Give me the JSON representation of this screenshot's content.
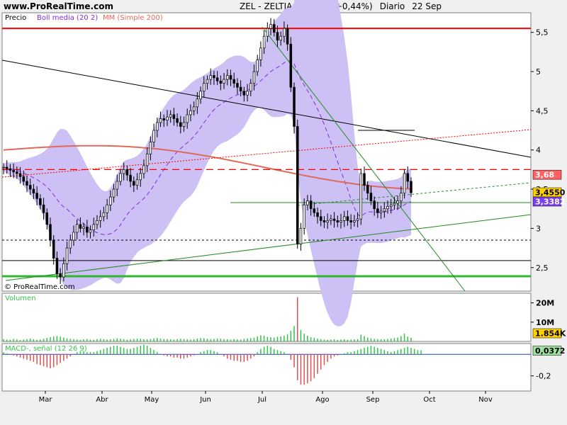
{
  "header": {
    "site": "www.ProRealTime.com",
    "symbol": "ZEL - ZELTIA",
    "price": "3,4550 (+0,44%)",
    "period": "Diario",
    "date": "22 Sep"
  },
  "watermark": "© ProRealTime.com",
  "colors": {
    "candle_up": "#ffffff",
    "candle_down": "#000000",
    "boll_band": "#ccc0f4",
    "boll_mid": "#8a2be2",
    "mm200": "#e06a5a",
    "support_red": "#ff0000",
    "trend_green": "#228b22",
    "volume": "#34c34a",
    "macd_pos": "#34c34a",
    "macd_neg": "#e05050"
  },
  "chart_data": [
    {
      "type": "candlestick",
      "legend": [
        "Precio",
        "Boll media (20 2)",
        "MM (Simple 200)"
      ],
      "x_ticks": [
        "Mar",
        "Abr",
        "May",
        "Jun",
        "Jul",
        "Ago",
        "Sep",
        "Oct",
        "Nov"
      ],
      "y_ticks": [
        "2,5",
        "3",
        "3,5",
        "4",
        "4,5",
        "5",
        "5,5"
      ],
      "ylim": [
        2.2,
        5.75
      ],
      "price_labels": {
        "level_368": "3,68",
        "last_close": "3,4550",
        "boll_mid": "3,3382"
      },
      "levels": {
        "resistance": 5.55,
        "dashed_red": 3.75,
        "dotted_black": 2.85,
        "black_support": 2.59,
        "green_support": 2.39
      },
      "close_approx": [
        3.78,
        3.76,
        3.74,
        3.72,
        3.7,
        3.66,
        3.6,
        3.55,
        3.5,
        3.45,
        3.38,
        3.3,
        3.2,
        3.05,
        2.85,
        2.62,
        2.42,
        2.38,
        2.55,
        2.75,
        2.85,
        2.95,
        3.05,
        3.0,
        3.02,
        2.95,
        2.98,
        3.05,
        3.1,
        3.15,
        3.2,
        3.3,
        3.4,
        3.5,
        3.6,
        3.7,
        3.75,
        3.68,
        3.6,
        3.55,
        3.62,
        3.7,
        3.8,
        3.95,
        4.1,
        4.25,
        4.35,
        4.4,
        4.38,
        4.42,
        4.45,
        4.4,
        4.35,
        4.3,
        4.35,
        4.45,
        4.5,
        4.55,
        4.65,
        4.75,
        4.85,
        4.9,
        4.95,
        4.92,
        4.88,
        4.85,
        4.9,
        4.95,
        4.9,
        4.85,
        4.8,
        4.75,
        4.7,
        4.75,
        4.85,
        5.0,
        5.15,
        5.3,
        5.45,
        5.55,
        5.6,
        5.5,
        5.4,
        5.45,
        5.55,
        5.35,
        4.8,
        4.3,
        2.8,
        3.0,
        3.3,
        3.35,
        3.25,
        3.2,
        3.15,
        3.1,
        3.08,
        3.1,
        3.12,
        3.1,
        3.08,
        3.1,
        3.15,
        3.1,
        3.08,
        3.1,
        3.12,
        3.7,
        3.55,
        3.45,
        3.35,
        3.25,
        3.2,
        3.22,
        3.25,
        3.28,
        3.3,
        3.32,
        3.35,
        3.45,
        3.7,
        3.6,
        3.455
      ]
    },
    {
      "type": "bar",
      "title": "Volumen",
      "y_ticks": [
        "20M",
        "10M"
      ],
      "ylim": [
        0,
        25
      ],
      "last_label": "1.854K",
      "values_m": [
        1.2,
        1.0,
        0.9,
        1.3,
        1.1,
        0.8,
        1.0,
        1.2,
        1.5,
        1.1,
        0.9,
        1.0,
        1.4,
        1.8,
        2.2,
        2.6,
        2.8,
        2.5,
        2.0,
        1.6,
        1.4,
        1.2,
        1.0,
        0.9,
        1.1,
        1.3,
        1.0,
        0.9,
        1.2,
        1.4,
        1.2,
        1.0,
        1.1,
        1.3,
        1.6,
        1.4,
        1.2,
        1.0,
        1.1,
        1.3,
        1.5,
        1.4,
        1.2,
        1.1,
        1.3,
        1.6,
        1.8,
        1.5,
        1.3,
        1.2,
        1.1,
        1.0,
        1.2,
        1.4,
        1.3,
        1.1,
        1.0,
        1.2,
        1.5,
        1.7,
        1.6,
        1.4,
        1.2,
        1.3,
        1.5,
        1.4,
        1.2,
        1.1,
        1.0,
        1.2,
        1.1,
        1.0,
        1.3,
        1.5,
        1.7,
        2.0,
        2.6,
        3.2,
        3.0,
        2.4,
        2.2,
        2.0,
        2.4,
        2.6,
        3.0,
        3.8,
        5.5,
        8.0,
        23.0,
        6.0,
        4.0,
        3.0,
        2.2,
        1.8,
        1.5,
        1.2,
        1.0,
        0.9,
        1.0,
        1.1,
        0.9,
        1.0,
        1.1,
        0.9,
        1.0,
        1.1,
        1.2,
        3.5,
        2.8,
        2.0,
        1.6,
        1.3,
        1.2,
        1.1,
        1.2,
        1.3,
        1.5,
        1.7,
        2.0,
        2.8,
        4.0,
        2.5,
        1.854
      ]
    },
    {
      "type": "bar",
      "title": "MACD-, señal (12 26 9)",
      "y_ticks": [
        "0,0372",
        "-0,2"
      ],
      "ylim": [
        -0.34,
        0.1
      ],
      "values": [
        0.02,
        0.01,
        0.0,
        -0.01,
        -0.02,
        -0.03,
        -0.04,
        -0.05,
        -0.06,
        -0.07,
        -0.09,
        -0.1,
        -0.11,
        -0.12,
        -0.13,
        -0.12,
        -0.1,
        -0.08,
        -0.06,
        -0.04,
        -0.02,
        0.0,
        0.02,
        0.03,
        0.03,
        0.02,
        0.02,
        0.02,
        0.03,
        0.04,
        0.05,
        0.06,
        0.07,
        0.08,
        0.08,
        0.07,
        0.06,
        0.05,
        0.05,
        0.06,
        0.07,
        0.08,
        0.09,
        0.08,
        0.06,
        0.04,
        0.02,
        0.0,
        -0.01,
        -0.02,
        -0.02,
        -0.03,
        -0.03,
        -0.04,
        -0.04,
        -0.03,
        -0.02,
        -0.01,
        0.0,
        0.02,
        0.03,
        0.04,
        0.04,
        0.03,
        0.02,
        0.0,
        -0.02,
        -0.04,
        -0.05,
        -0.06,
        -0.06,
        -0.07,
        -0.07,
        -0.06,
        -0.04,
        -0.02,
        0.02,
        0.05,
        0.07,
        0.08,
        0.07,
        0.05,
        0.04,
        0.03,
        0.02,
        0.0,
        -0.05,
        -0.12,
        -0.24,
        -0.28,
        -0.28,
        -0.27,
        -0.25,
        -0.22,
        -0.18,
        -0.14,
        -0.1,
        -0.07,
        -0.04,
        -0.02,
        -0.01,
        0.0,
        0.01,
        0.02,
        0.02,
        0.03,
        0.04,
        0.05,
        0.06,
        0.07,
        0.08,
        0.07,
        0.06,
        0.05,
        0.04,
        0.03,
        0.02,
        0.03,
        0.04,
        0.05,
        0.06,
        0.07,
        0.06,
        0.05,
        0.04,
        0.0372
      ]
    }
  ]
}
